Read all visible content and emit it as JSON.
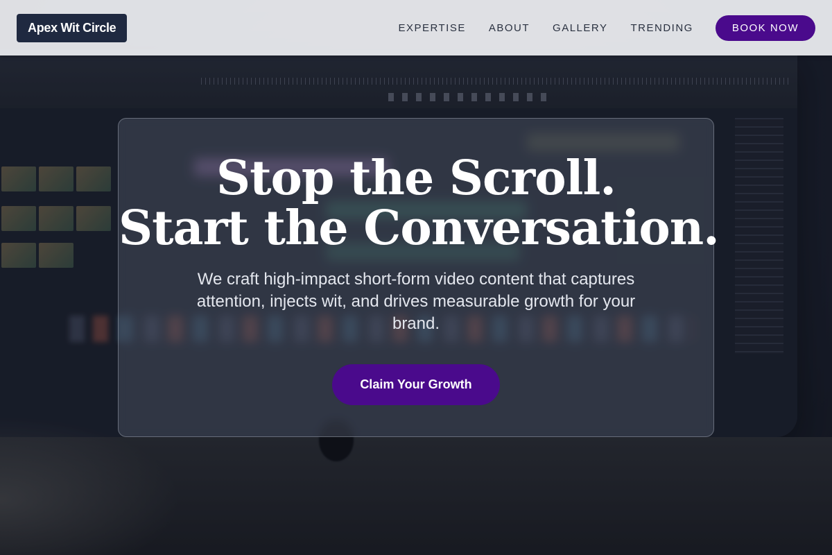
{
  "brand": {
    "name": "Apex Wit Circle"
  },
  "nav": {
    "links": [
      "EXPERTISE",
      "ABOUT",
      "GALLERY",
      "TRENDING"
    ],
    "cta_label": "BOOK NOW"
  },
  "hero": {
    "title_line1": "Stop the Scroll.",
    "title_line2": "Start the Conversation.",
    "subtitle": "We craft high-impact short-form video content that captures attention, injects wit, and drives measurable growth for your brand.",
    "cta_label": "Claim Your Growth"
  },
  "colors": {
    "accent": "#4a0a8c",
    "brand_bg": "#1f2940",
    "header_bg": "#f0f1f4"
  }
}
